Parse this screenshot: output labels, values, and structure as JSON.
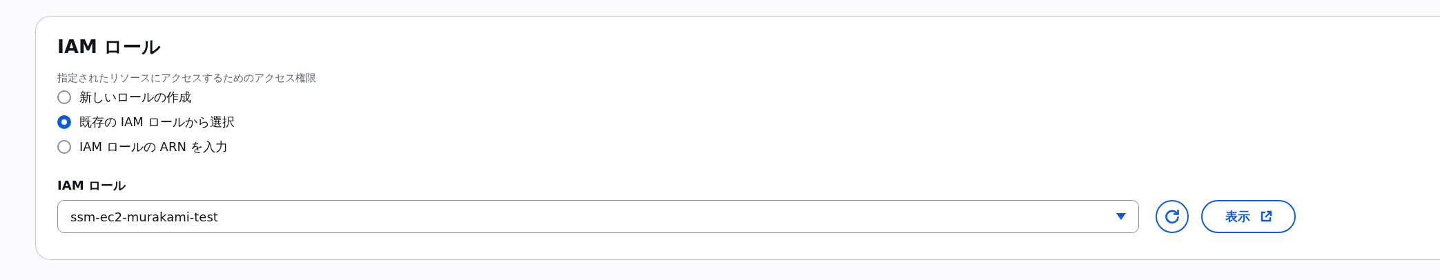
{
  "panel": {
    "title": "IAM ロール",
    "description": "指定されたリソースにアクセスするためのアクセス権限",
    "options": [
      {
        "label": "新しいロールの作成",
        "selected": false
      },
      {
        "label": "既存の IAM ロールから選択",
        "selected": true
      },
      {
        "label": "IAM ロールの ARN を入力",
        "selected": false
      }
    ],
    "role_field": {
      "label": "IAM ロール",
      "value": "ssm-ec2-murakami-test"
    },
    "view_button": {
      "label": "表示"
    }
  }
}
